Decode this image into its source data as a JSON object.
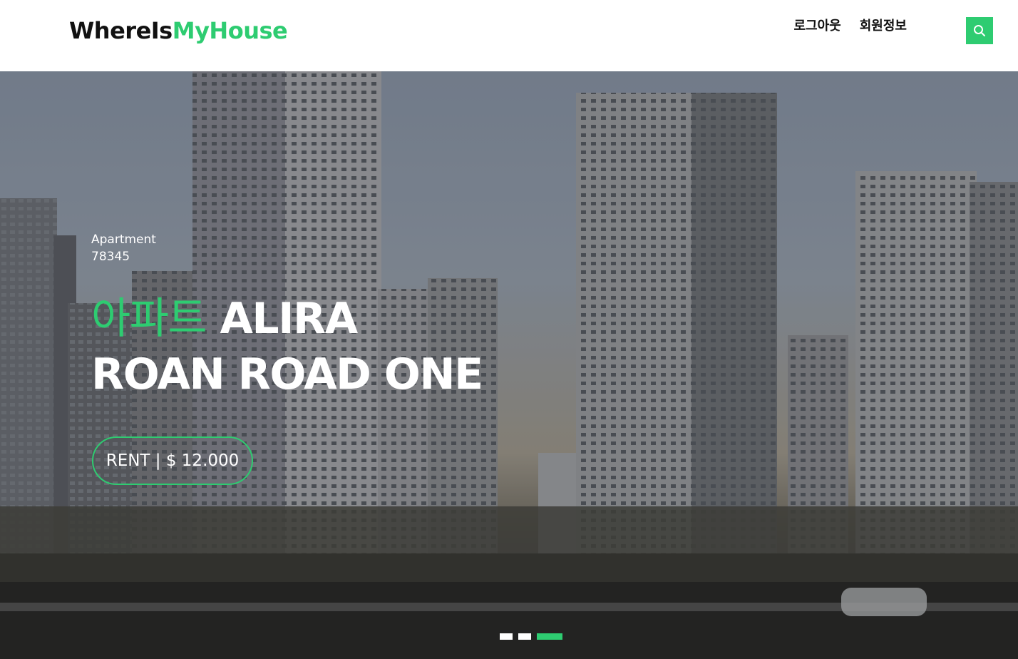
{
  "brand": {
    "part1": "WhereIs",
    "part2": "MyHouse",
    "accent_color": "#2ecc71"
  },
  "nav": {
    "items": [
      {
        "label": "로그아웃"
      },
      {
        "label": "회원정보"
      }
    ]
  },
  "search": {
    "icon": "search-icon"
  },
  "hero": {
    "type": "Apartment",
    "number": "78345",
    "title_accent": "아파트",
    "title_rest": "ALIRA",
    "title_line2": "ROAN ROAD ONE",
    "rent_label": "RENT | $ 12.000"
  },
  "carousel": {
    "slides": 3,
    "active_index": 2
  }
}
